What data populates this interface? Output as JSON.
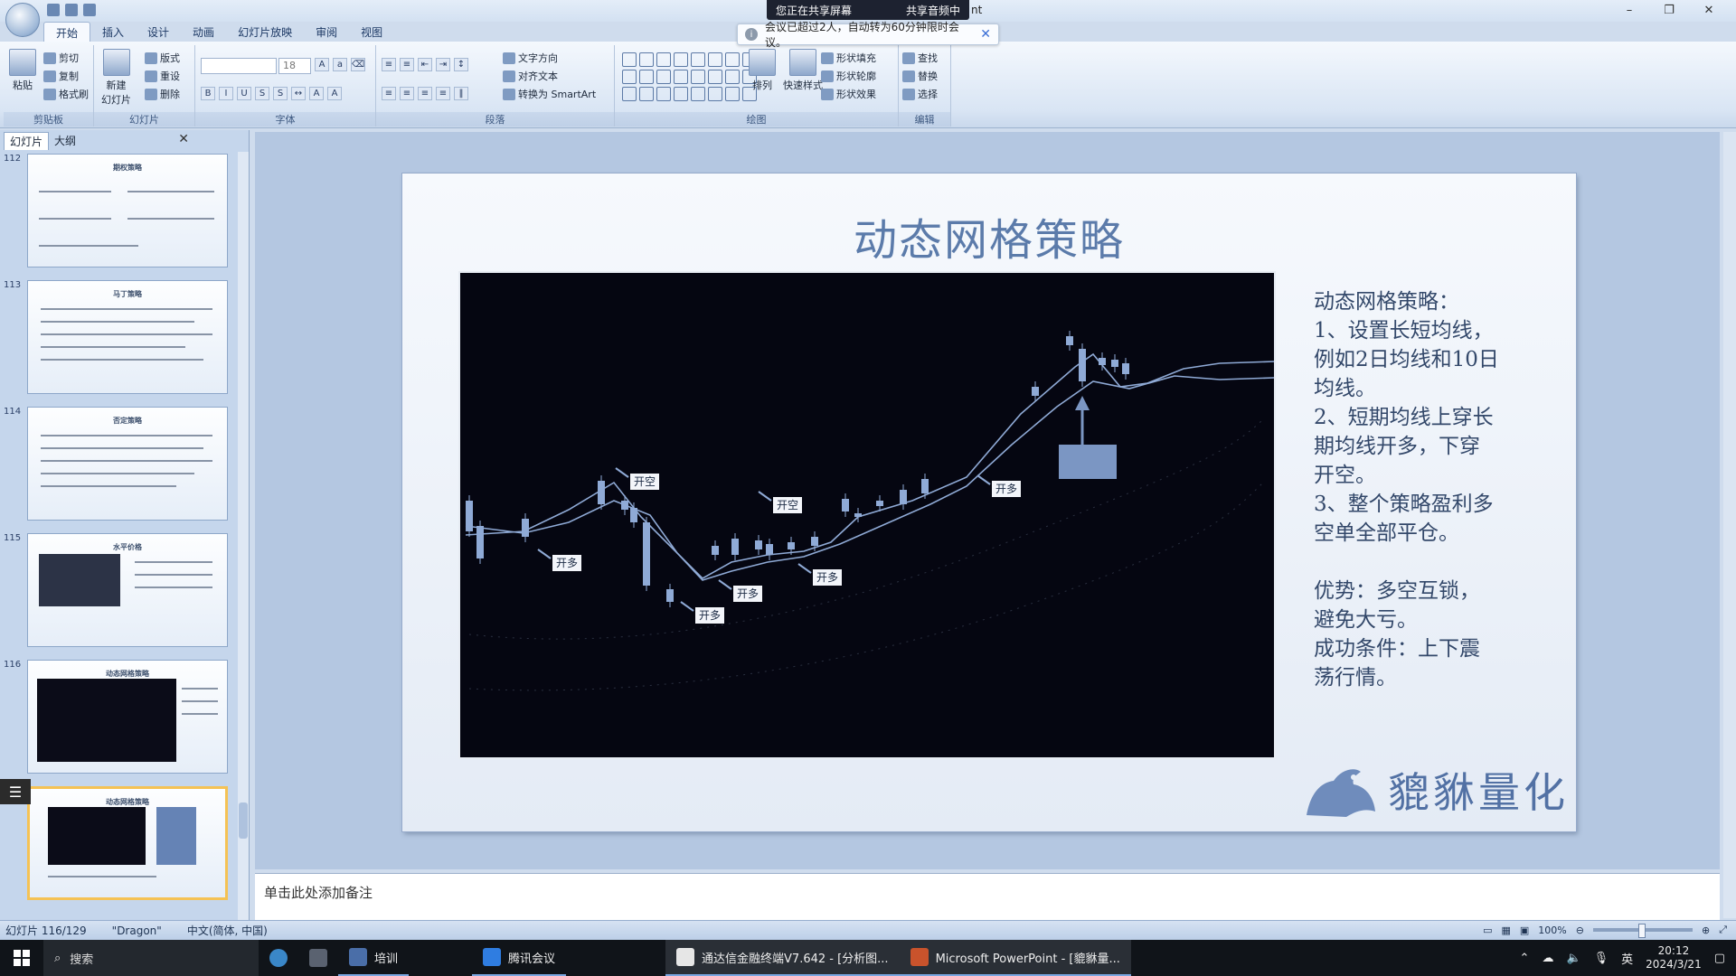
{
  "titlebar": {
    "share_status": "您正在共享屏幕",
    "share_audio": "共享音频中",
    "share_suffix": "nt",
    "notice": "会议已超过2人，自动转为60分钟限时会议。",
    "win_min": "–",
    "win_max": "❐",
    "win_close": "✕"
  },
  "ribbon": {
    "tabs": [
      "开始",
      "插入",
      "设计",
      "动画",
      "幻灯片放映",
      "审阅",
      "视图"
    ],
    "groups": {
      "clipboard": "剪贴板",
      "slides": "幻灯片",
      "font": "字体",
      "paragraph": "段落",
      "drawing": "绘图",
      "editing": "编辑"
    },
    "clipboard": {
      "paste": "粘贴",
      "cut": "剪切",
      "copy": "复制",
      "format": "格式刷"
    },
    "slides": {
      "new": "新建\n幻灯片",
      "layout": "版式",
      "reset": "重设",
      "delete": "删除"
    },
    "font": {
      "size": "18"
    },
    "paragraph": {
      "text_direction": "文字方向",
      "align_text": "对齐文本",
      "smartart": "转换为 SmartArt"
    },
    "drawing": {
      "arrange": "排列",
      "quick_styles": "快速样式",
      "fill": "形状填充",
      "outline": "形状轮廓",
      "effects": "形状效果"
    },
    "editing": {
      "find": "查找",
      "replace": "替换",
      "select": "选择"
    }
  },
  "leftpanel": {
    "tab_slides": "幻灯片",
    "tab_outline": "大纲",
    "close": "✕",
    "thumbs": [
      {
        "num": "112",
        "title": "期权策略"
      },
      {
        "num": "113",
        "title": "马丁策略"
      },
      {
        "num": "114",
        "title": "否定策略"
      },
      {
        "num": "115",
        "title": "水平价格"
      },
      {
        "num": "116",
        "title": "动态网格策略"
      },
      {
        "num": "",
        "title": "动态网格策略"
      }
    ]
  },
  "slide": {
    "title": "动态网格策略",
    "side_lines": [
      "动态网格策略：",
      "1、设置长短均线，",
      "例如2日均线和10日",
      "均线。",
      "2、短期均线上穿长",
      "期均线开多，下穿",
      "开空。",
      "3、整个策略盈利多",
      "空单全部平仓。"
    ],
    "advantage_lines": [
      "优势：多空互锁，",
      "避免大亏。",
      "成功条件：上下震",
      "荡行情。"
    ],
    "logo_text": "貔貅量化"
  },
  "chart_data": {
    "type": "candlestick",
    "annotations": [
      "开空",
      "开多",
      "开多",
      "开多",
      "开空",
      "开多",
      "开多"
    ]
  },
  "notes": {
    "placeholder": "单击此处添加备注"
  },
  "statusbar": {
    "slide_info": "幻灯片 116/129",
    "theme": "\"Dragon\"",
    "language": "中文(简体, 中国)",
    "zoom": "100%"
  },
  "taskbar": {
    "search": "搜索",
    "apps": [
      "培训",
      "腾讯会议",
      "通达信金融终端V7.642 - [分析图...",
      "Microsoft PowerPoint - [貔貅量..."
    ],
    "ime": "英",
    "time": "20:12",
    "date": "2024/3/21"
  },
  "colors": {
    "accent": "#5b7baa",
    "chart_bg": "#050611",
    "candle": "#8faad6",
    "ma_line": "#8faad6"
  }
}
